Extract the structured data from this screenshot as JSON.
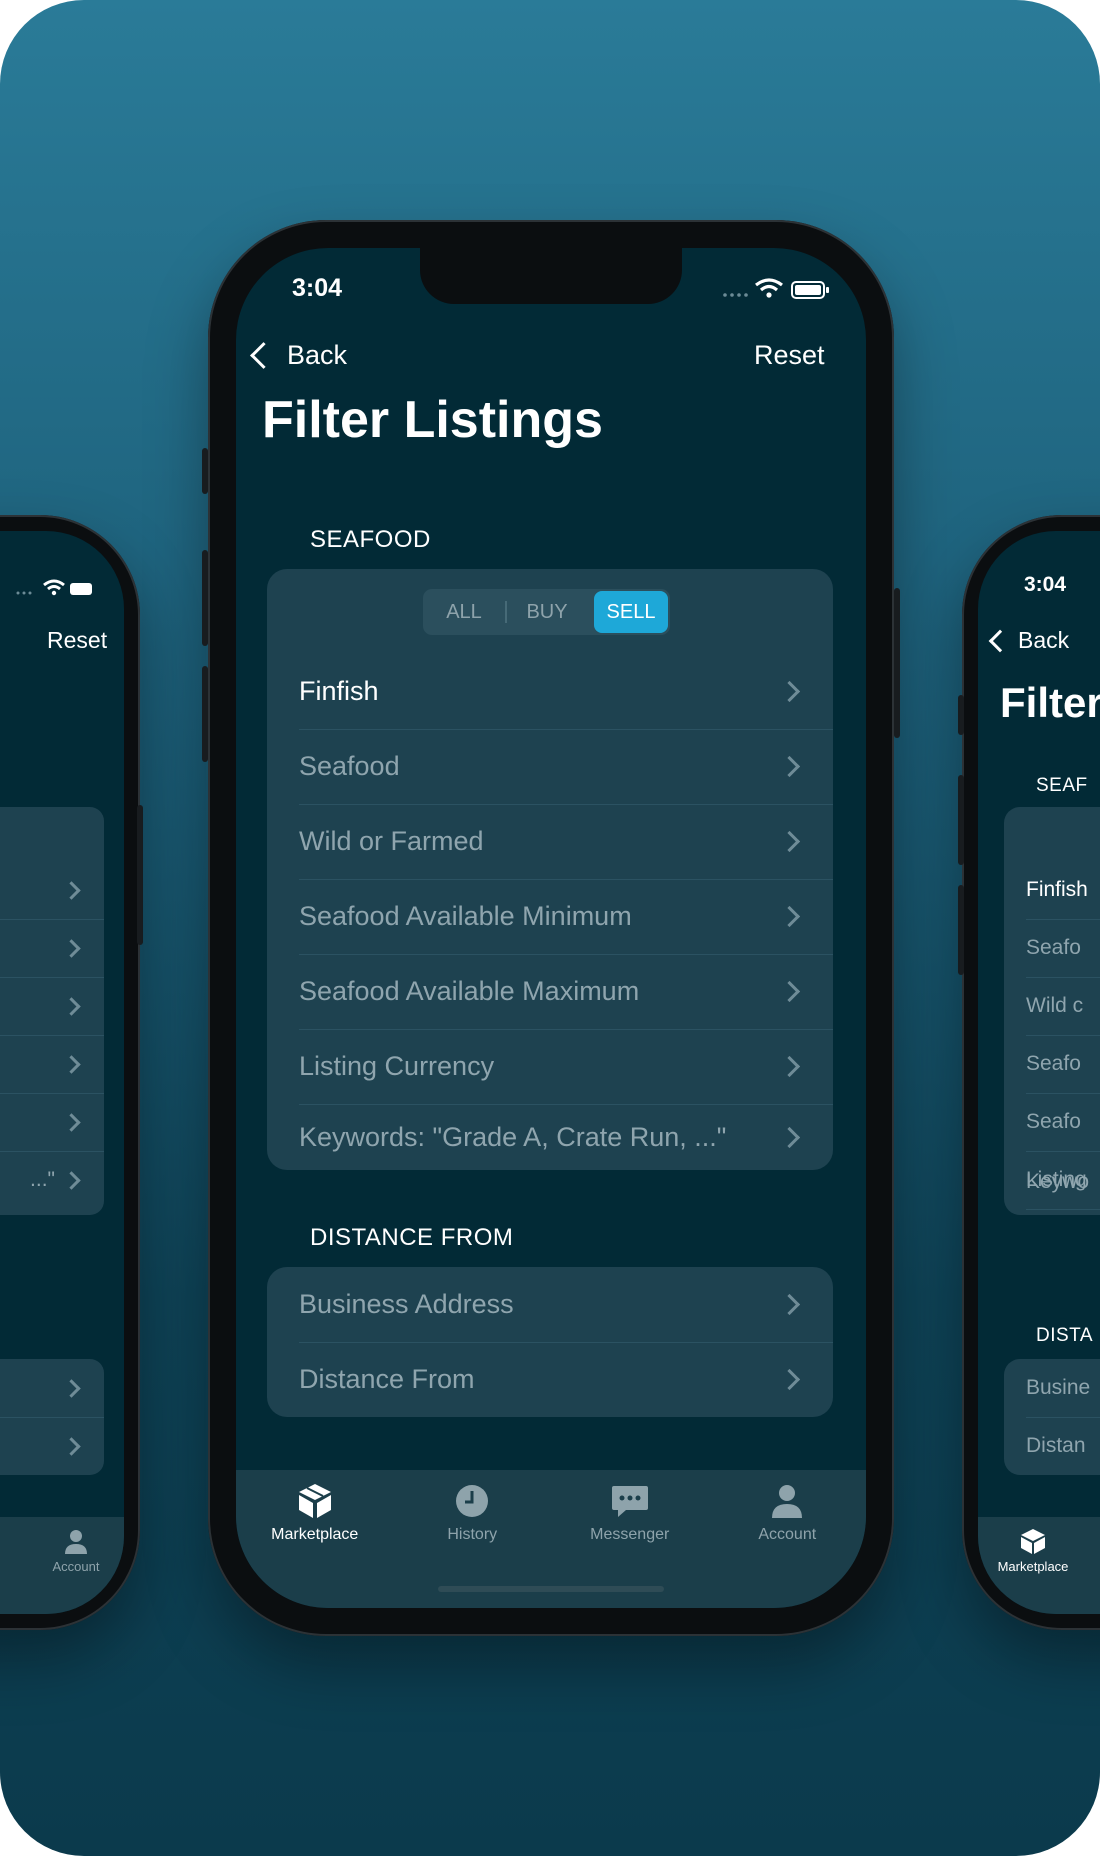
{
  "colors": {
    "background_top": "#2a7b98",
    "background_bottom": "#0b3a4c",
    "screen": "#022a36",
    "card": "#1e4250",
    "accent": "#1ea8d8",
    "tabbar": "#1b3e4a"
  },
  "center": {
    "status": {
      "time": "3:04"
    },
    "nav": {
      "back_label": "Back",
      "reset_label": "Reset"
    },
    "title": "Filter Listings",
    "seafood_section": {
      "header": "SEAFOOD",
      "segments": [
        "ALL",
        "BUY",
        "SELL"
      ],
      "selected_segment": "SELL",
      "rows": [
        "Finfish",
        "Seafood",
        "Wild or Farmed",
        "Seafood Available Minimum",
        "Seafood Available Maximum",
        "Listing Currency",
        "Keywords: \"Grade A, Crate Run, ...\""
      ]
    },
    "distance_section": {
      "header": "DISTANCE FROM",
      "rows": [
        "Business Address",
        "Distance From"
      ]
    },
    "tabbar": {
      "tabs": [
        {
          "label": "Marketplace",
          "icon": "package-icon",
          "active": true
        },
        {
          "label": "History",
          "icon": "clock-icon",
          "active": false
        },
        {
          "label": "Messenger",
          "icon": "chat-bubble-icon",
          "active": false
        },
        {
          "label": "Account",
          "icon": "person-icon",
          "active": false
        }
      ]
    }
  },
  "left": {
    "nav": {
      "reset_label": "Reset"
    },
    "rows_tail": [
      "...\""
    ],
    "tabbar": {
      "label": "Account"
    }
  },
  "right": {
    "status": {
      "time": "3:04"
    },
    "nav": {
      "back_label": "Back"
    },
    "title": "Filter",
    "seafood_header": "SEAF",
    "rows": [
      "Finfish",
      "Seafo",
      "Wild c",
      "Seafo",
      "Seafo",
      "Listing",
      "Keywo"
    ],
    "distance_header": "DISTA",
    "distance_rows": [
      "Busine",
      "Distan"
    ],
    "tabbar": {
      "label": "Marketplace"
    }
  }
}
